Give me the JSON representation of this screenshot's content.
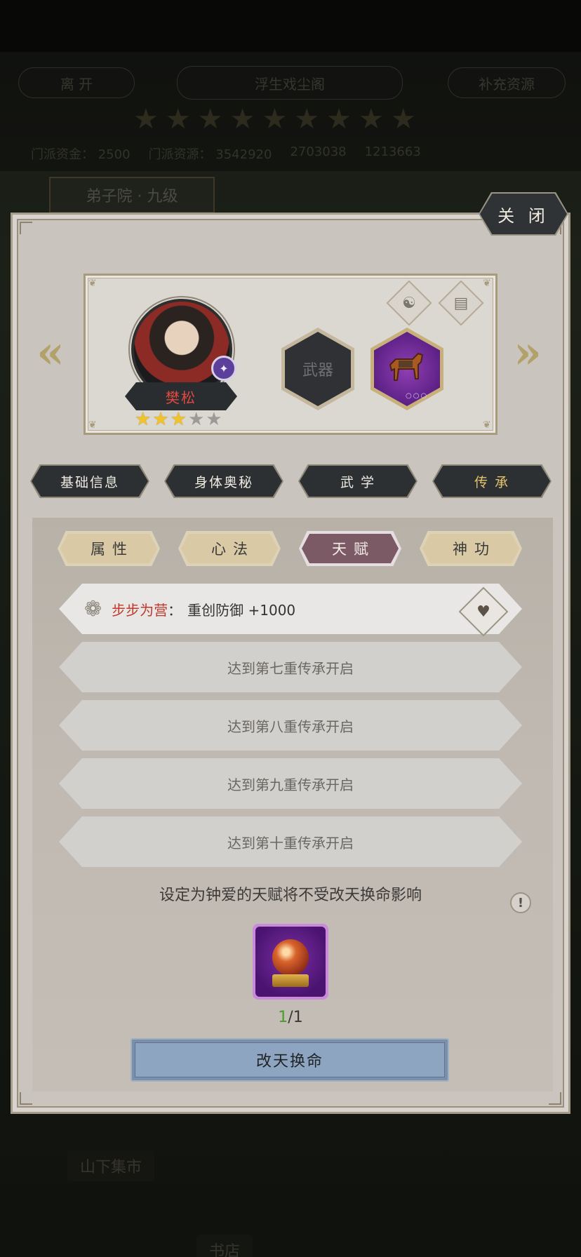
{
  "background": {
    "leave_label": "离 开",
    "hall_title": "浮生戏尘阁",
    "replenish_label": "补充资源",
    "resources": [
      "门派资金：",
      "2500",
      "门派资源：",
      "3542920",
      "2703038",
      "1213663"
    ],
    "building_label": "弟子院 · 九级",
    "market_label": "山下集市",
    "shop_label": "书店"
  },
  "modal": {
    "close_label": "关 闭"
  },
  "character": {
    "name": "樊松",
    "stars_filled": 3,
    "stars_total": 5,
    "weapon_slot_label": "武器",
    "arrow_left": "«",
    "arrow_right": "»"
  },
  "main_tabs": [
    {
      "label": "基础信息",
      "active": false
    },
    {
      "label": "身体奥秘",
      "active": false
    },
    {
      "label": "武 学",
      "active": false
    },
    {
      "label": "传 承",
      "active": true
    }
  ],
  "sub_tabs": [
    {
      "label": "属性",
      "active": false
    },
    {
      "label": "心法",
      "active": false
    },
    {
      "label": "天赋",
      "active": true
    },
    {
      "label": "神功",
      "active": false
    }
  ],
  "talents": {
    "active": {
      "name": "步步为营",
      "colon": "：",
      "effect": "重创防御 +1000"
    },
    "locked": [
      "达到第七重传承开启",
      "达到第八重传承开启",
      "达到第九重传承开启",
      "达到第十重传承开启"
    ]
  },
  "notice": "设定为钟爱的天赋将不受改天换命影响",
  "item": {
    "current": "1",
    "separator": "/",
    "total": "1"
  },
  "action_button_label": "改天换命",
  "icons": [
    "gear-icon",
    "heart-icon",
    "yin-yang-icon",
    "book-icon",
    "info-icon",
    "horse-icon",
    "orb-icon"
  ],
  "colors": {
    "talent_name": "#c0392b",
    "active_subtab": "#7b5a66",
    "action_button": "#8ea5c2",
    "count_current": "#4b9b2c"
  }
}
